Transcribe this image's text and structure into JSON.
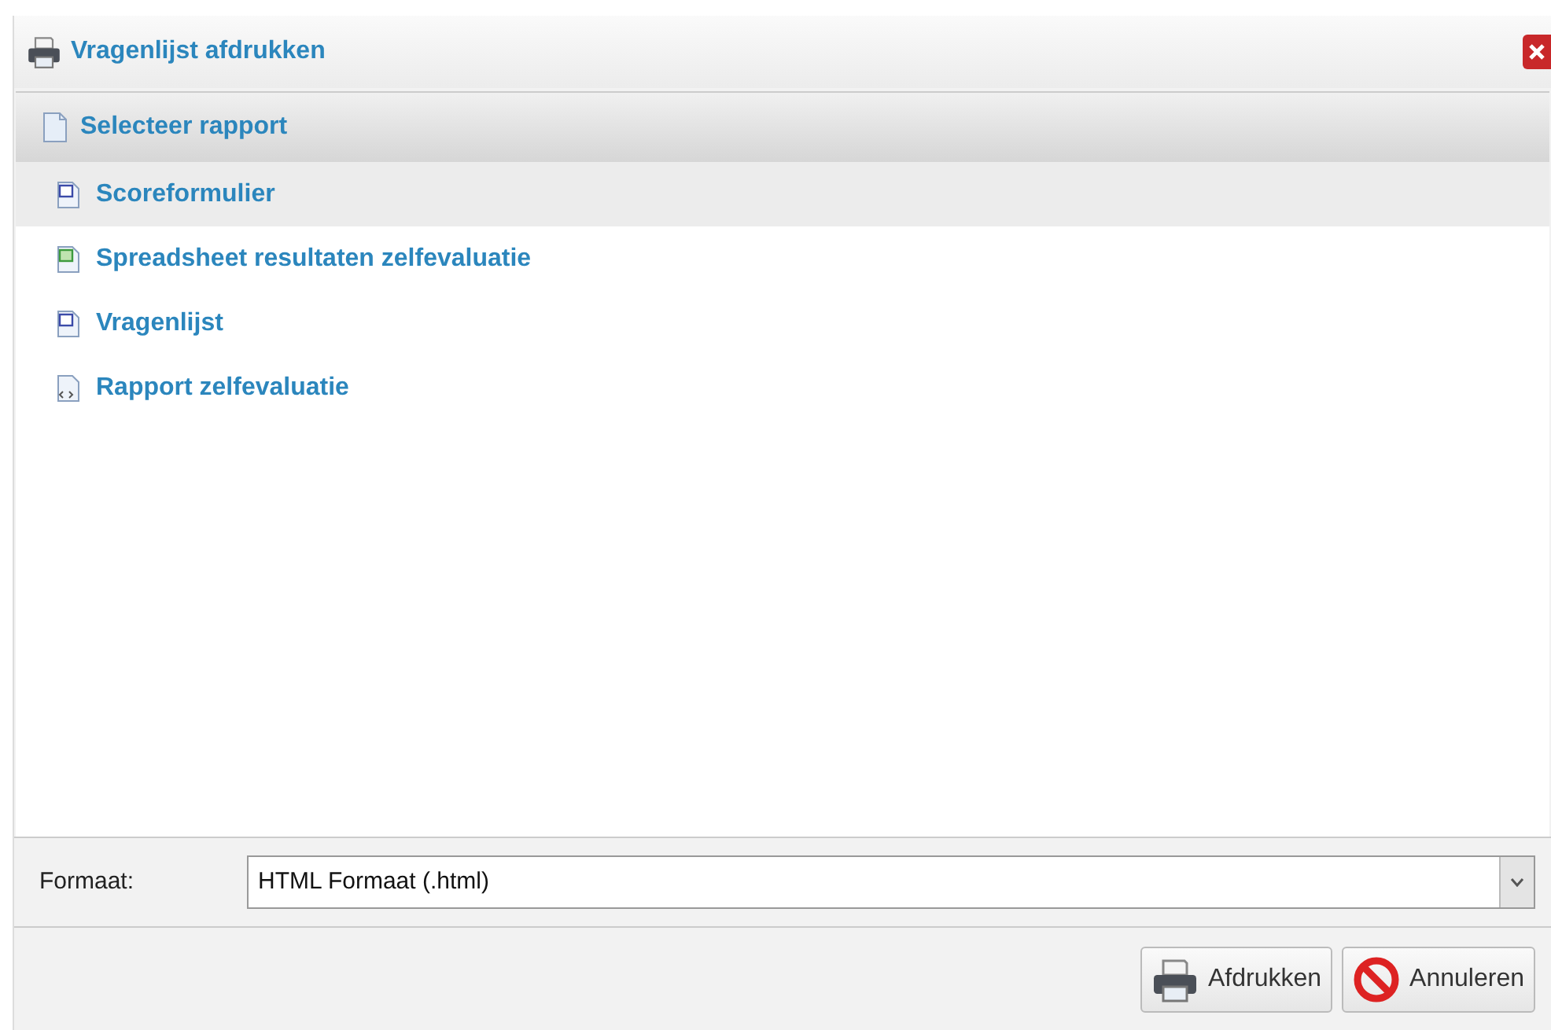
{
  "dialog": {
    "title": "Vragenlijst afdrukken"
  },
  "panel": {
    "title": "Selecteer rapport"
  },
  "reports": [
    {
      "kind": "word",
      "label": "Scoreformulier",
      "selected": true
    },
    {
      "kind": "excel",
      "label": "Spreadsheet resultaten zelfevaluatie",
      "selected": false
    },
    {
      "kind": "word",
      "label": "Vragenlijst",
      "selected": false
    },
    {
      "kind": "html",
      "label": "Rapport zelfevaluatie",
      "selected": false
    }
  ],
  "format": {
    "label": "Formaat:",
    "value": "HTML Formaat (.html)"
  },
  "buttons": [
    {
      "kind": "print",
      "label": "Afdrukken"
    },
    {
      "kind": "cancel",
      "label": "Annuleren"
    }
  ]
}
